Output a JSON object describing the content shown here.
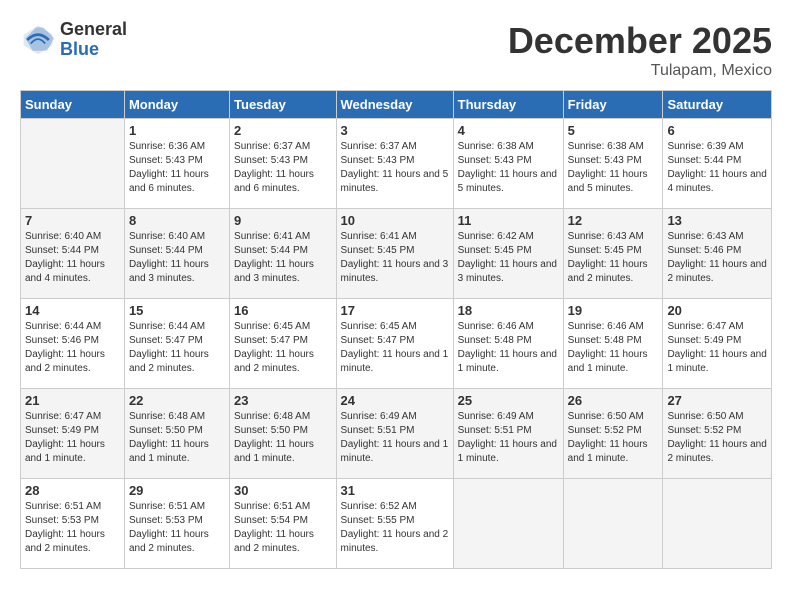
{
  "header": {
    "logo_general": "General",
    "logo_blue": "Blue",
    "month_title": "December 2025",
    "location": "Tulapam, Mexico"
  },
  "days_of_week": [
    "Sunday",
    "Monday",
    "Tuesday",
    "Wednesday",
    "Thursday",
    "Friday",
    "Saturday"
  ],
  "weeks": [
    [
      {
        "day": "",
        "empty": true
      },
      {
        "day": "1",
        "sunrise": "Sunrise: 6:36 AM",
        "sunset": "Sunset: 5:43 PM",
        "daylight": "Daylight: 11 hours and 6 minutes."
      },
      {
        "day": "2",
        "sunrise": "Sunrise: 6:37 AM",
        "sunset": "Sunset: 5:43 PM",
        "daylight": "Daylight: 11 hours and 6 minutes."
      },
      {
        "day": "3",
        "sunrise": "Sunrise: 6:37 AM",
        "sunset": "Sunset: 5:43 PM",
        "daylight": "Daylight: 11 hours and 5 minutes."
      },
      {
        "day": "4",
        "sunrise": "Sunrise: 6:38 AM",
        "sunset": "Sunset: 5:43 PM",
        "daylight": "Daylight: 11 hours and 5 minutes."
      },
      {
        "day": "5",
        "sunrise": "Sunrise: 6:38 AM",
        "sunset": "Sunset: 5:43 PM",
        "daylight": "Daylight: 11 hours and 5 minutes."
      },
      {
        "day": "6",
        "sunrise": "Sunrise: 6:39 AM",
        "sunset": "Sunset: 5:44 PM",
        "daylight": "Daylight: 11 hours and 4 minutes."
      }
    ],
    [
      {
        "day": "7",
        "sunrise": "Sunrise: 6:40 AM",
        "sunset": "Sunset: 5:44 PM",
        "daylight": "Daylight: 11 hours and 4 minutes."
      },
      {
        "day": "8",
        "sunrise": "Sunrise: 6:40 AM",
        "sunset": "Sunset: 5:44 PM",
        "daylight": "Daylight: 11 hours and 3 minutes."
      },
      {
        "day": "9",
        "sunrise": "Sunrise: 6:41 AM",
        "sunset": "Sunset: 5:44 PM",
        "daylight": "Daylight: 11 hours and 3 minutes."
      },
      {
        "day": "10",
        "sunrise": "Sunrise: 6:41 AM",
        "sunset": "Sunset: 5:45 PM",
        "daylight": "Daylight: 11 hours and 3 minutes."
      },
      {
        "day": "11",
        "sunrise": "Sunrise: 6:42 AM",
        "sunset": "Sunset: 5:45 PM",
        "daylight": "Daylight: 11 hours and 3 minutes."
      },
      {
        "day": "12",
        "sunrise": "Sunrise: 6:43 AM",
        "sunset": "Sunset: 5:45 PM",
        "daylight": "Daylight: 11 hours and 2 minutes."
      },
      {
        "day": "13",
        "sunrise": "Sunrise: 6:43 AM",
        "sunset": "Sunset: 5:46 PM",
        "daylight": "Daylight: 11 hours and 2 minutes."
      }
    ],
    [
      {
        "day": "14",
        "sunrise": "Sunrise: 6:44 AM",
        "sunset": "Sunset: 5:46 PM",
        "daylight": "Daylight: 11 hours and 2 minutes."
      },
      {
        "day": "15",
        "sunrise": "Sunrise: 6:44 AM",
        "sunset": "Sunset: 5:47 PM",
        "daylight": "Daylight: 11 hours and 2 minutes."
      },
      {
        "day": "16",
        "sunrise": "Sunrise: 6:45 AM",
        "sunset": "Sunset: 5:47 PM",
        "daylight": "Daylight: 11 hours and 2 minutes."
      },
      {
        "day": "17",
        "sunrise": "Sunrise: 6:45 AM",
        "sunset": "Sunset: 5:47 PM",
        "daylight": "Daylight: 11 hours and 1 minute."
      },
      {
        "day": "18",
        "sunrise": "Sunrise: 6:46 AM",
        "sunset": "Sunset: 5:48 PM",
        "daylight": "Daylight: 11 hours and 1 minute."
      },
      {
        "day": "19",
        "sunrise": "Sunrise: 6:46 AM",
        "sunset": "Sunset: 5:48 PM",
        "daylight": "Daylight: 11 hours and 1 minute."
      },
      {
        "day": "20",
        "sunrise": "Sunrise: 6:47 AM",
        "sunset": "Sunset: 5:49 PM",
        "daylight": "Daylight: 11 hours and 1 minute."
      }
    ],
    [
      {
        "day": "21",
        "sunrise": "Sunrise: 6:47 AM",
        "sunset": "Sunset: 5:49 PM",
        "daylight": "Daylight: 11 hours and 1 minute."
      },
      {
        "day": "22",
        "sunrise": "Sunrise: 6:48 AM",
        "sunset": "Sunset: 5:50 PM",
        "daylight": "Daylight: 11 hours and 1 minute."
      },
      {
        "day": "23",
        "sunrise": "Sunrise: 6:48 AM",
        "sunset": "Sunset: 5:50 PM",
        "daylight": "Daylight: 11 hours and 1 minute."
      },
      {
        "day": "24",
        "sunrise": "Sunrise: 6:49 AM",
        "sunset": "Sunset: 5:51 PM",
        "daylight": "Daylight: 11 hours and 1 minute."
      },
      {
        "day": "25",
        "sunrise": "Sunrise: 6:49 AM",
        "sunset": "Sunset: 5:51 PM",
        "daylight": "Daylight: 11 hours and 1 minute."
      },
      {
        "day": "26",
        "sunrise": "Sunrise: 6:50 AM",
        "sunset": "Sunset: 5:52 PM",
        "daylight": "Daylight: 11 hours and 1 minute."
      },
      {
        "day": "27",
        "sunrise": "Sunrise: 6:50 AM",
        "sunset": "Sunset: 5:52 PM",
        "daylight": "Daylight: 11 hours and 2 minutes."
      }
    ],
    [
      {
        "day": "28",
        "sunrise": "Sunrise: 6:51 AM",
        "sunset": "Sunset: 5:53 PM",
        "daylight": "Daylight: 11 hours and 2 minutes."
      },
      {
        "day": "29",
        "sunrise": "Sunrise: 6:51 AM",
        "sunset": "Sunset: 5:53 PM",
        "daylight": "Daylight: 11 hours and 2 minutes."
      },
      {
        "day": "30",
        "sunrise": "Sunrise: 6:51 AM",
        "sunset": "Sunset: 5:54 PM",
        "daylight": "Daylight: 11 hours and 2 minutes."
      },
      {
        "day": "31",
        "sunrise": "Sunrise: 6:52 AM",
        "sunset": "Sunset: 5:55 PM",
        "daylight": "Daylight: 11 hours and 2 minutes."
      },
      {
        "day": "",
        "empty": true
      },
      {
        "day": "",
        "empty": true
      },
      {
        "day": "",
        "empty": true
      }
    ]
  ]
}
